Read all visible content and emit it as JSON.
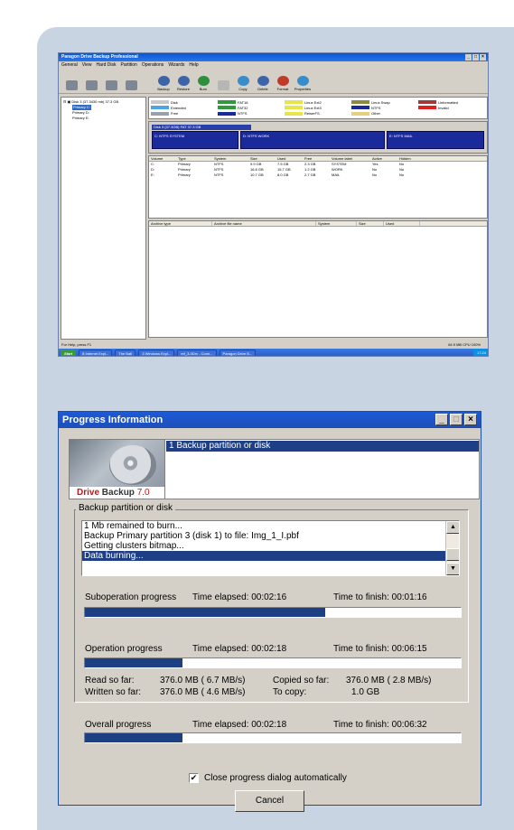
{
  "main_window": {
    "title": "Paragon Drive Backup Professional",
    "menu": [
      "General",
      "View",
      "Hard Disk",
      "Partition",
      "Operations",
      "Wizards",
      "Help"
    ],
    "toolbar_left": [
      "",
      "",
      "",
      ""
    ],
    "toolbar": [
      "Backup",
      "Restore",
      "Burn",
      "",
      "Copy",
      "Delete",
      "Format",
      "Properties"
    ],
    "tree": {
      "disk": "Disk 3 (37.3430 mb) 37.3 GB",
      "items": [
        "Primary C:",
        "Primary D:",
        "Primary E:"
      ]
    },
    "legend": [
      {
        "label": "Disk",
        "color": "#c8c8c8"
      },
      {
        "label": "FAT16",
        "color": "#2f9a3b"
      },
      {
        "label": "Linux Ext2",
        "color": "#e6e64a"
      },
      {
        "label": "Linux Swap",
        "color": "#8a8a40"
      },
      {
        "label": "Unformatted",
        "color": "#a23a3a"
      },
      {
        "label": "Extended",
        "color": "#4aa6e0"
      },
      {
        "label": "FAT32",
        "color": "#2f9a3b"
      },
      {
        "label": "Linux Ext3",
        "color": "#e6e64a"
      },
      {
        "label": "NTFS",
        "color": "#1a2a9a"
      },
      {
        "label": "Invalid",
        "color": "#e02020"
      },
      {
        "label": "Free",
        "color": "#9aa0a8"
      },
      {
        "label": "NTFS",
        "color": "#1a2a9a"
      },
      {
        "label": "ReiserFS",
        "color": "#e6e64a"
      },
      {
        "label": "Other",
        "color": "#e6d080"
      }
    ],
    "disk_header": "Disk 3 (37.3GB) FAT 37.3 GB",
    "partitions": [
      "C: NTFS SYSTEM",
      "D: NTFS WORK",
      "E: NTFS MAIL"
    ],
    "volume_columns": [
      "Volume",
      "Type",
      "System",
      "Size",
      "Used",
      "Free",
      "Volume label",
      "Active",
      "Hidden"
    ],
    "volumes": [
      [
        "C:",
        "Primary",
        "NTFS",
        "9.9 GB",
        "7.5 GB",
        "2.3 GB",
        "SYSTEM",
        "Yes",
        "No"
      ],
      [
        "D:",
        "Primary",
        "NTFS",
        "16.8 GB",
        "15.7 GB",
        "1.2 GB",
        "WORK",
        "No",
        "No"
      ],
      [
        "E:",
        "Primary",
        "NTFS",
        "10.7 GB",
        "8.0 GB",
        "2.7 GB",
        "MAIL",
        "No",
        "No"
      ]
    ],
    "archive_columns": [
      "Archive type",
      "Archive file name",
      "System",
      "Size",
      "Used"
    ],
    "status_left": "For Help, press F1",
    "status_right": "64.9 MB    CPU 100%",
    "taskbar": {
      "start": "Start",
      "buttons": [
        "8 Internet Expl...",
        "The Bat!",
        "3 Windows Expl...",
        "ref_3-0Drv - Conn...",
        "Paragon Drive B..."
      ],
      "clock": "17:24"
    }
  },
  "dialog": {
    "title": "Progress Information",
    "logo": {
      "brand_a": "Drive",
      "brand_b": "Backup",
      "version": "7.0"
    },
    "steps": [
      "1   Backup partition or disk"
    ],
    "group_title": "Backup partition or disk",
    "log": [
      "1 Mb remained to burn...",
      "Backup Primary partition 3 (disk 1) to file: Img_1_I.pbf",
      "Getting clusters bitmap...",
      "Data burning..."
    ],
    "log_selected_index": 3,
    "suboperation": {
      "label": "Suboperation progress",
      "elapsed": "Time elapsed: 00:02:16",
      "finish": "Time to finish: 00:01:16",
      "progress": 0.64
    },
    "operation": {
      "label": "Operation progress",
      "elapsed": "Time elapsed: 00:02:18",
      "finish": "Time to finish: 00:06:15",
      "progress": 0.26
    },
    "stats": {
      "read_label": "Read so far:",
      "read_value": "376.0 MB ( 6.7 MB/s)",
      "copied_label": "Copied so far:",
      "copied_value": "376.0 MB ( 2.8 MB/s)",
      "written_label": "Written so far:",
      "written_value": "376.0 MB ( 4.6 MB/s)",
      "tocopy_label": "To copy:",
      "tocopy_value": "1.0 GB"
    },
    "overall": {
      "label": "Overall progress",
      "elapsed": "Time elapsed: 00:02:18",
      "finish": "Time to finish: 00:06:32",
      "progress": 0.26
    },
    "checkbox_label": "Close progress dialog automatically",
    "checkbox_checked": true,
    "cancel_label": "Cancel"
  }
}
